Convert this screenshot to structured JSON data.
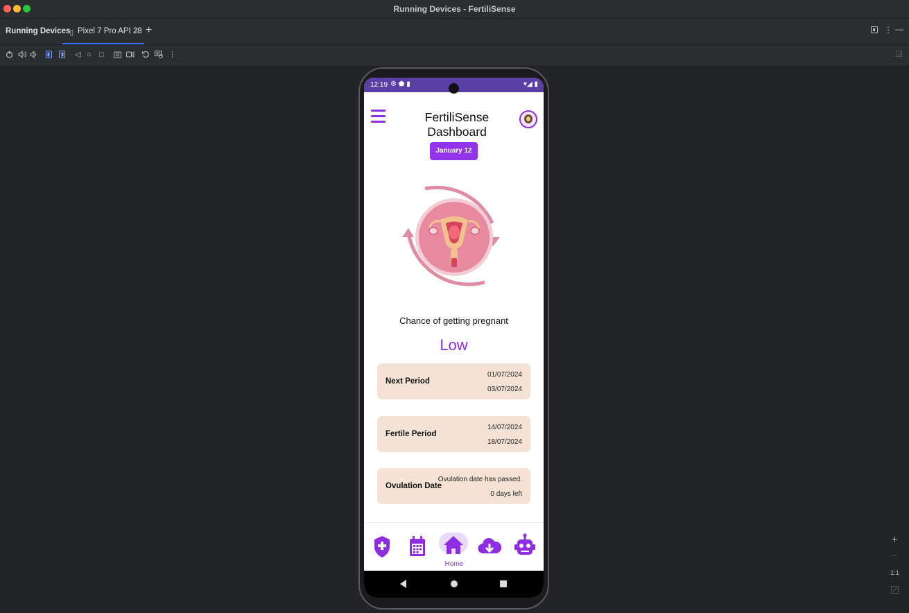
{
  "window": {
    "title": "Running Devices - FertiliSense"
  },
  "tabs": {
    "section_label": "Running Devices",
    "active_tab": "Pixel 7 Pro API 28",
    "close_glyph": "x",
    "add_glyph": "+"
  },
  "toolbar_icons": [
    "power-icon",
    "volume-up-icon",
    "volume-down-icon",
    "rotate-left-icon",
    "rotate-right-icon",
    "back-icon",
    "home-icon",
    "overview-icon",
    "screenshot-icon",
    "screen-record-icon",
    "reset-icon",
    "snapshot-icon",
    "more-icon"
  ],
  "phone": {
    "status": {
      "time": "12:19",
      "left_icons": "⚙ ⬟ ▮",
      "right_icons": "▾◢ ▮"
    },
    "header": {
      "title": "FertiliSense Dashboard"
    },
    "date_chip": "January 12",
    "chance_label": "Chance of getting pregnant",
    "chance_value": "Low",
    "cards": [
      {
        "label": "Next Period",
        "line1": "01/07/2024",
        "line2": "03/07/2024"
      },
      {
        "label": "Fertile Period",
        "line1": "14/07/2024",
        "line2": "18/07/2024"
      },
      {
        "label": "Ovulation Date",
        "line1": "Ovulation date has passed.",
        "line2": "0 days left"
      }
    ],
    "bottom_nav": {
      "items": [
        "shield-plus-icon",
        "calendar-icon",
        "home-icon",
        "cloud-download-icon",
        "robot-icon"
      ],
      "active_label": "Home"
    }
  },
  "zoom_controls": {
    "plus": "+",
    "minus": "−",
    "one_to_one": "1:1"
  },
  "colors": {
    "accent": "#8e2de2",
    "status_bar": "#5b3fa6",
    "card_bg": "#f4e3d5",
    "illustration_pink": "#e08aa3"
  }
}
